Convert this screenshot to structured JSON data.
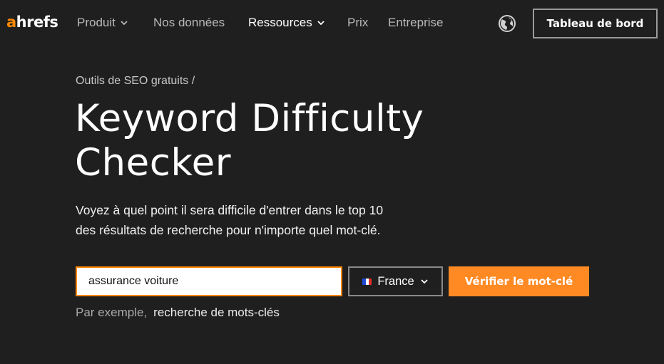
{
  "logo": {
    "first_letter": "a",
    "rest": "hrefs"
  },
  "nav": {
    "items": [
      {
        "label": "Produit",
        "has_dropdown": true
      },
      {
        "label": "Nos données",
        "has_dropdown": false
      },
      {
        "label": "Ressources",
        "has_dropdown": true,
        "active": true
      },
      {
        "label": "Prix",
        "has_dropdown": false
      },
      {
        "label": "Entreprise",
        "has_dropdown": false
      }
    ],
    "language_icon": "globe-icon",
    "dashboard_label": "Tableau de bord"
  },
  "hero": {
    "breadcrumb": "Outils de SEO gratuits /",
    "title_line1": "Keyword Difficulty",
    "title_line2": "Checker",
    "subtitle_line1": "Voyez à quel point il sera difficile d'entrer dans le top 10",
    "subtitle_line2": "des résultats de recherche pour n'importe quel mot-clé."
  },
  "search": {
    "value": "assurance voiture",
    "country": "France",
    "country_flag_icon": "france-flag-icon",
    "submit_label": "Vérifier le mot-clé",
    "example_label": "Par exemple,",
    "example_link": "recherche de mots-clés"
  },
  "colors": {
    "background": "#1f1f1f",
    "accent": "#ff8a24",
    "input_border": "#ff8800",
    "nav_text": "#b9b9b9"
  }
}
